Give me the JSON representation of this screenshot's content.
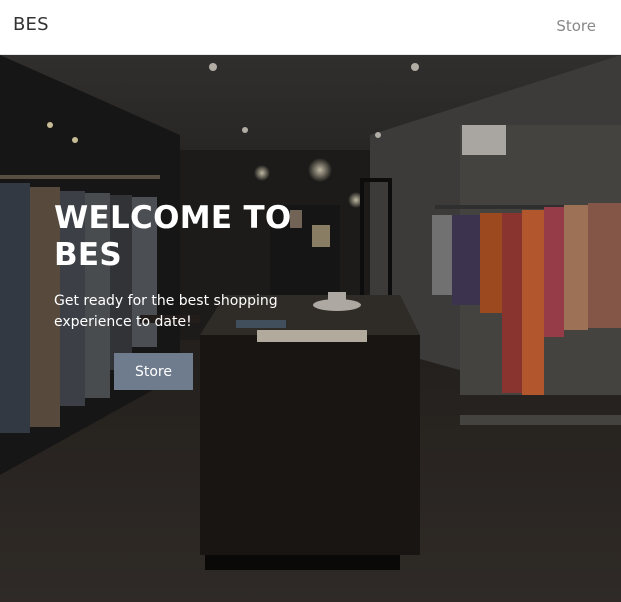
{
  "navbar": {
    "brand": "BES",
    "store_link": "Store"
  },
  "hero": {
    "title": "WELCOME TO BES",
    "subtitle": "Get ready for the best shopping experience to date!",
    "button_label": "Store"
  }
}
